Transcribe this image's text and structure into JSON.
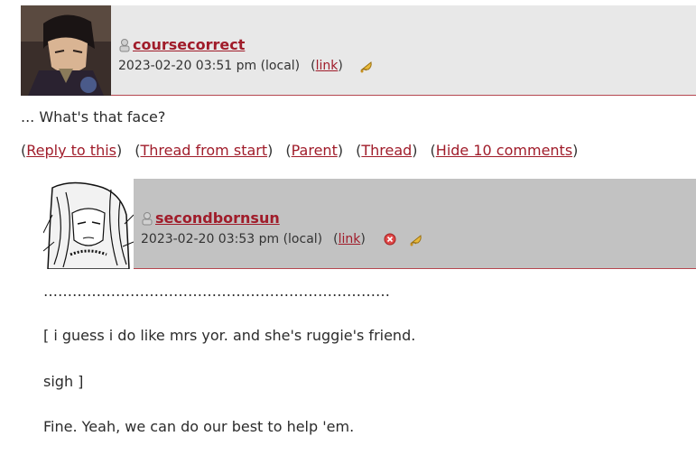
{
  "comments": [
    {
      "username": "coursecorrect",
      "timestamp": "2023-02-20 03:51 pm (local)",
      "link_label": "link",
      "body": "... What's that face?",
      "actions": {
        "reply": "Reply to this",
        "thread_from_start": "Thread from start",
        "parent": "Parent",
        "thread": "Thread",
        "hide": "Hide 10 comments"
      },
      "icons": [
        "user-icon",
        "bell-icon"
      ]
    },
    {
      "username": "secondbornsun",
      "timestamp": "2023-02-20 03:53 pm (local)",
      "link_label": "link",
      "body_lines": [
        "………………………………………………………………",
        "[ i guess i do like mrs yor. and she's ruggie's friend.",
        "sigh ]",
        "Fine. Yeah, we can do our best to help 'em."
      ],
      "icons": [
        "user-icon",
        "delete-icon",
        "bell-icon"
      ]
    }
  ],
  "colors": {
    "link": "#a01c2a",
    "header1_bg": "#e8e8e8",
    "header2_bg": "#c2c2c2",
    "divider": "#b5474f"
  }
}
